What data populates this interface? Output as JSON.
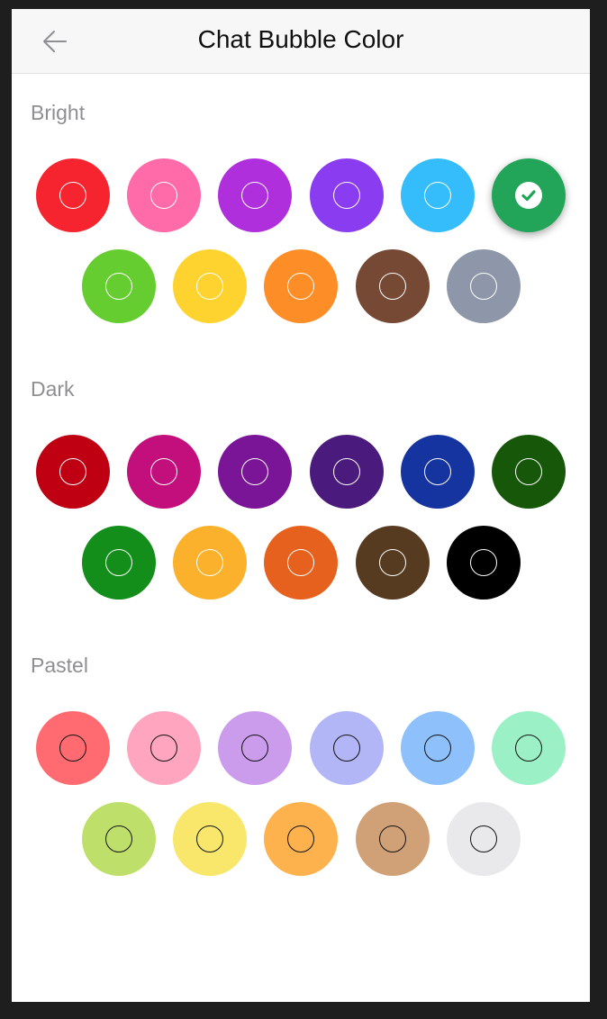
{
  "header": {
    "title": "Chat Bubble Color",
    "back_icon": "arrow-left-icon"
  },
  "selected": "bright-5",
  "sections": [
    {
      "label": "Bright",
      "swatches": [
        {
          "color": "#f5242f",
          "ring": "light"
        },
        {
          "color": "#ff6aa8",
          "ring": "light"
        },
        {
          "color": "#b02fdc",
          "ring": "light"
        },
        {
          "color": "#8a3df0",
          "ring": "light"
        },
        {
          "color": "#35bdfb",
          "ring": "light"
        },
        {
          "color": "#22a559",
          "ring": "light"
        },
        {
          "color": "#65cd2f",
          "ring": "light"
        },
        {
          "color": "#ffd32f",
          "ring": "light"
        },
        {
          "color": "#fd8d26",
          "ring": "light"
        },
        {
          "color": "#764935",
          "ring": "light"
        },
        {
          "color": "#8e97a9",
          "ring": "light"
        }
      ]
    },
    {
      "label": "Dark",
      "swatches": [
        {
          "color": "#be0012",
          "ring": "light"
        },
        {
          "color": "#c20f7c",
          "ring": "light"
        },
        {
          "color": "#7a1598",
          "ring": "light"
        },
        {
          "color": "#4b1a7d",
          "ring": "light"
        },
        {
          "color": "#1634a0",
          "ring": "light"
        },
        {
          "color": "#165709",
          "ring": "light"
        },
        {
          "color": "#138e1a",
          "ring": "light"
        },
        {
          "color": "#fbb12c",
          "ring": "light"
        },
        {
          "color": "#e6611d",
          "ring": "light"
        },
        {
          "color": "#573b21",
          "ring": "light"
        },
        {
          "color": "#000000",
          "ring": "light"
        }
      ]
    },
    {
      "label": "Pastel",
      "swatches": [
        {
          "color": "#ff6b70",
          "ring": "dark"
        },
        {
          "color": "#ffa5bf",
          "ring": "dark"
        },
        {
          "color": "#cb9cec",
          "ring": "dark"
        },
        {
          "color": "#b2b6f6",
          "ring": "dark"
        },
        {
          "color": "#8ec0fc",
          "ring": "dark"
        },
        {
          "color": "#9bf1c5",
          "ring": "dark"
        },
        {
          "color": "#bee06b",
          "ring": "dark"
        },
        {
          "color": "#f8e76b",
          "ring": "dark"
        },
        {
          "color": "#fdb24d",
          "ring": "dark"
        },
        {
          "color": "#d0a176",
          "ring": "dark"
        },
        {
          "color": "#e9e9eb",
          "ring": "dark"
        }
      ]
    }
  ]
}
